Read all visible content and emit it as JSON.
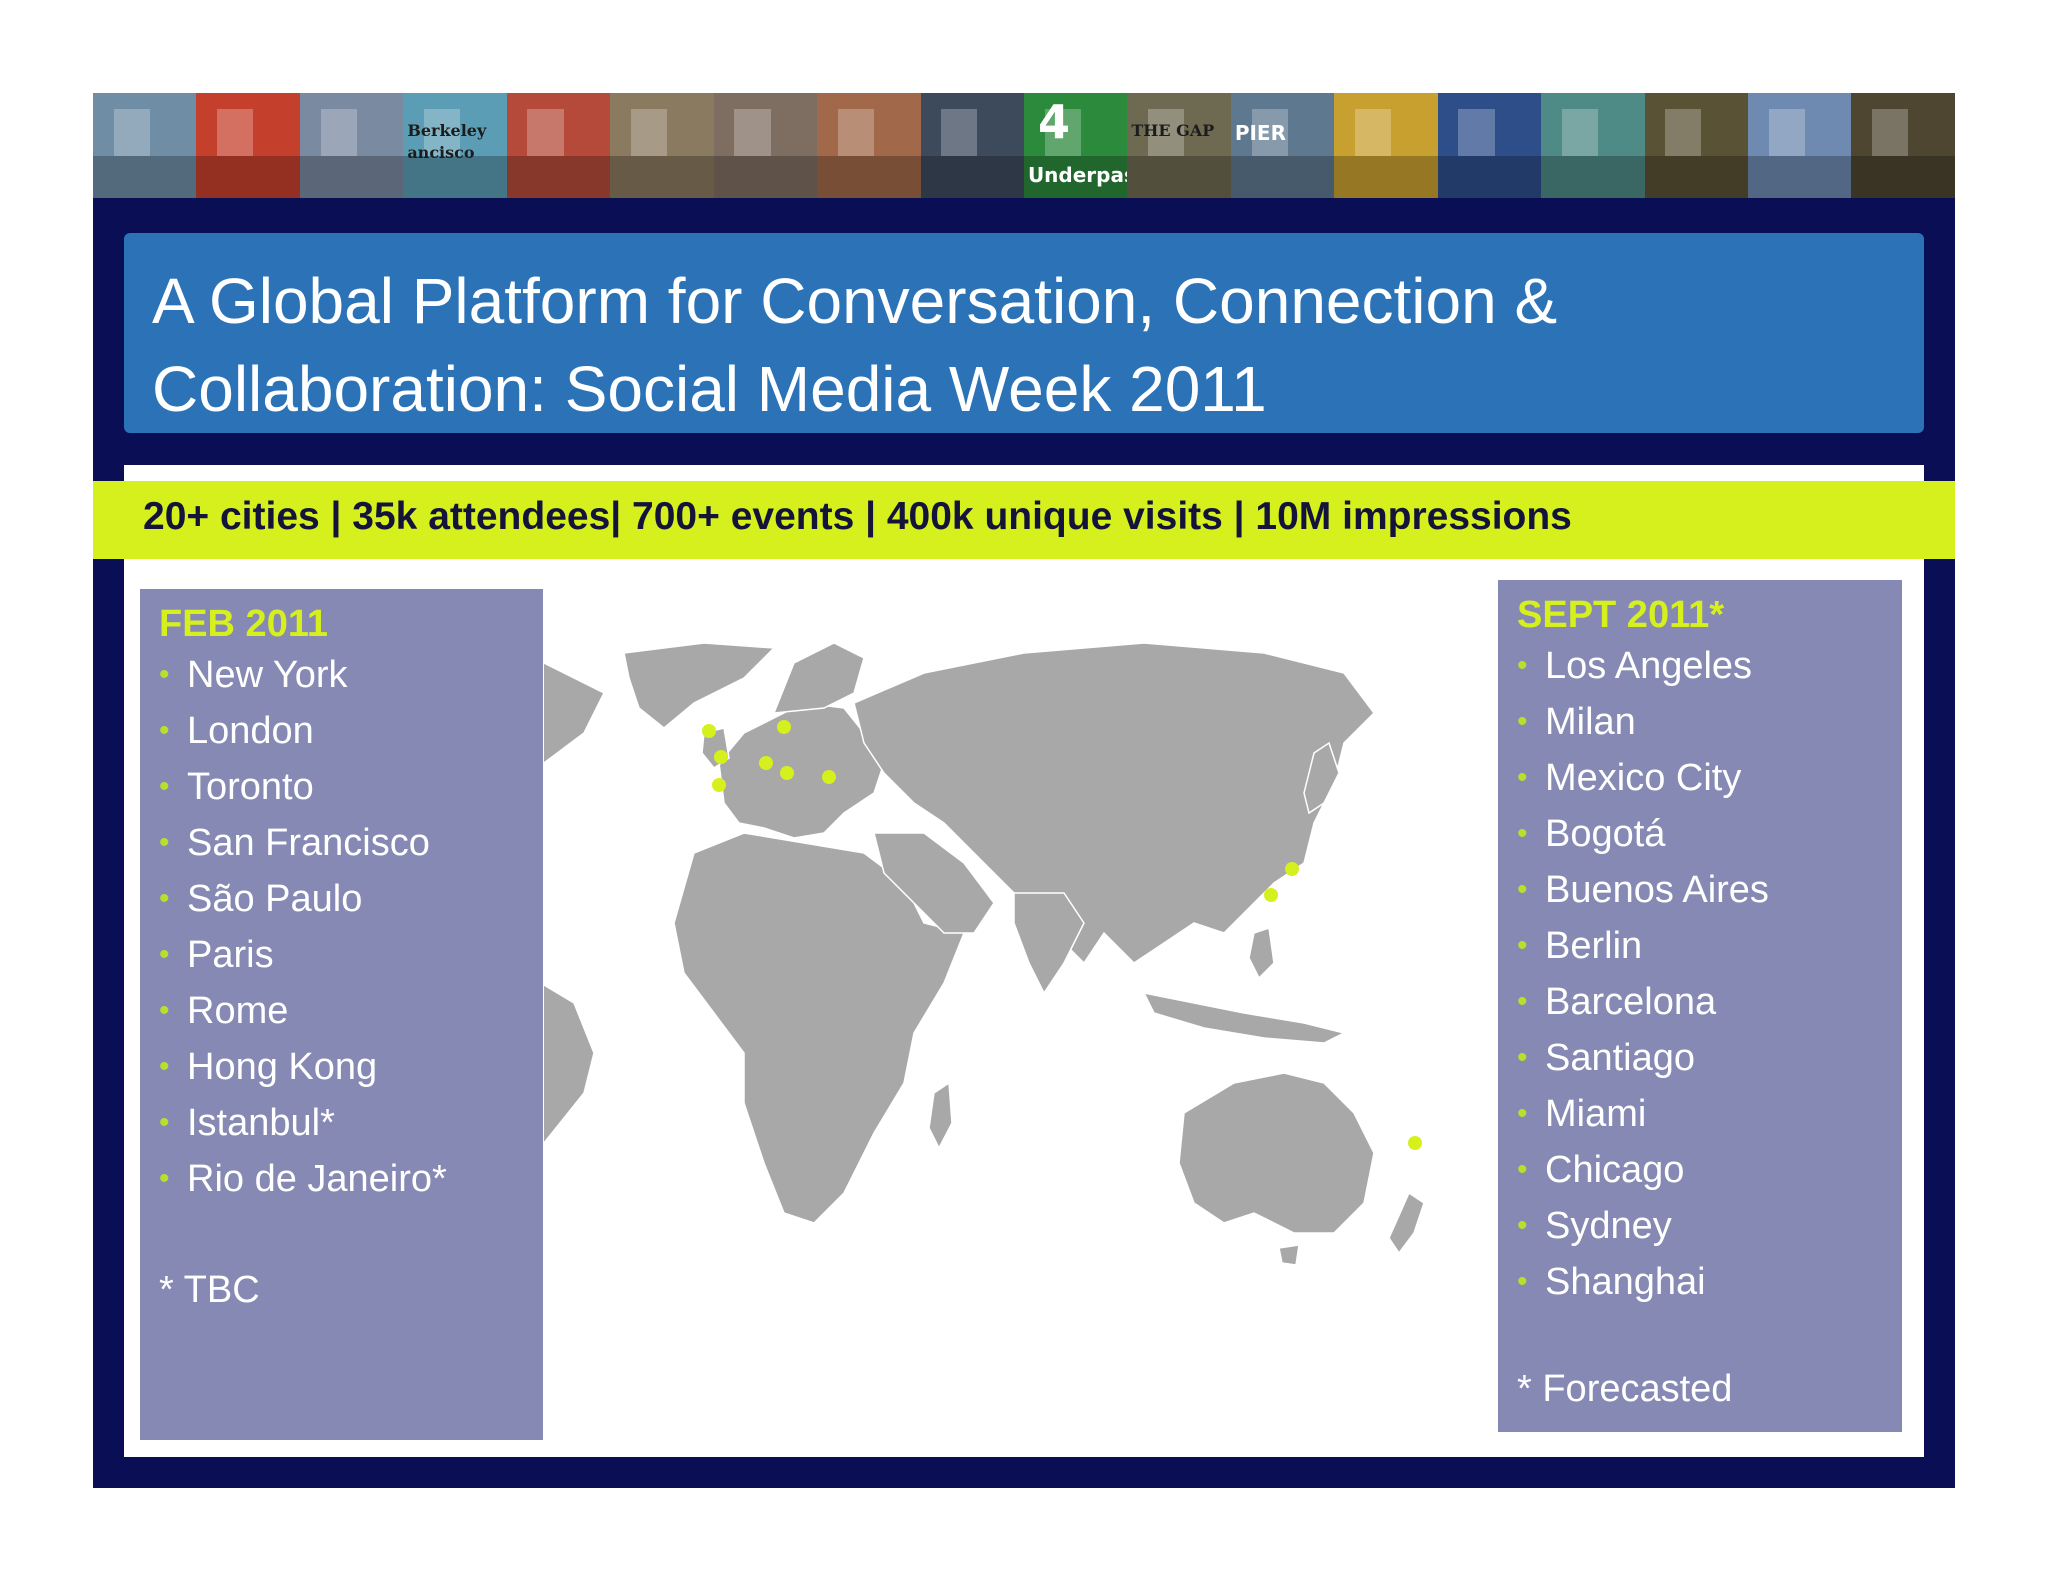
{
  "title": "A Global Platform for Conversation, Connection & Collaboration: Social Media Week 2011",
  "stats": "20+ cities | 35k attendees| 700+ events | 400k unique visits | 10M impressions",
  "photo_strip": {
    "tiles": [
      {
        "color": "#6f8ea6"
      },
      {
        "color": "#c4402d"
      },
      {
        "color": "#7a8aa0"
      },
      {
        "color": "#5b9db4"
      },
      {
        "color": "#b64a3a"
      },
      {
        "color": "#8a7a60"
      },
      {
        "color": "#7e6e62"
      },
      {
        "color": "#a2684a"
      },
      {
        "color": "#3c4a5c"
      },
      {
        "color": "#2c8a3c"
      },
      {
        "color": "#6e6a52"
      },
      {
        "color": "#5e7890"
      },
      {
        "color": "#c8a030"
      },
      {
        "color": "#2e4e8a"
      },
      {
        "color": "#4e8a86"
      },
      {
        "color": "#5a5234"
      },
      {
        "color": "#6e8ab0"
      },
      {
        "color": "#4e4630"
      }
    ],
    "signs": {
      "berkeley": "Berkeley",
      "francisco": "ancisco",
      "subway_number": "4",
      "underpass": "Underpass",
      "the_gap": "THE GAP",
      "pier": "PIER"
    }
  },
  "left_box": {
    "heading": "FEB 2011",
    "bullet": "•",
    "cities": [
      "New York",
      "London",
      "Toronto",
      "San Francisco",
      "São Paulo",
      "Paris",
      "Rome",
      "Hong Kong",
      "Istanbul*",
      "Rio de Janeiro*"
    ],
    "note": "* TBC"
  },
  "right_box": {
    "heading": "SEPT 2011*",
    "bullet": "•",
    "cities": [
      "Los Angeles",
      "Milan",
      "Mexico City",
      "Bogotá",
      "Buenos Aires",
      "Berlin",
      "Barcelona",
      "Santiago",
      "Miami",
      "Chicago",
      "Sydney",
      "Shanghai"
    ],
    "note": "* Forecasted"
  },
  "colors": {
    "frame": "#0a0e55",
    "title_bg": "#2b73b6",
    "stats_bg": "#d6f01e",
    "accent": "#d6f01e",
    "land": "#a8a8a8",
    "city_dot": "#d6f01e"
  }
}
